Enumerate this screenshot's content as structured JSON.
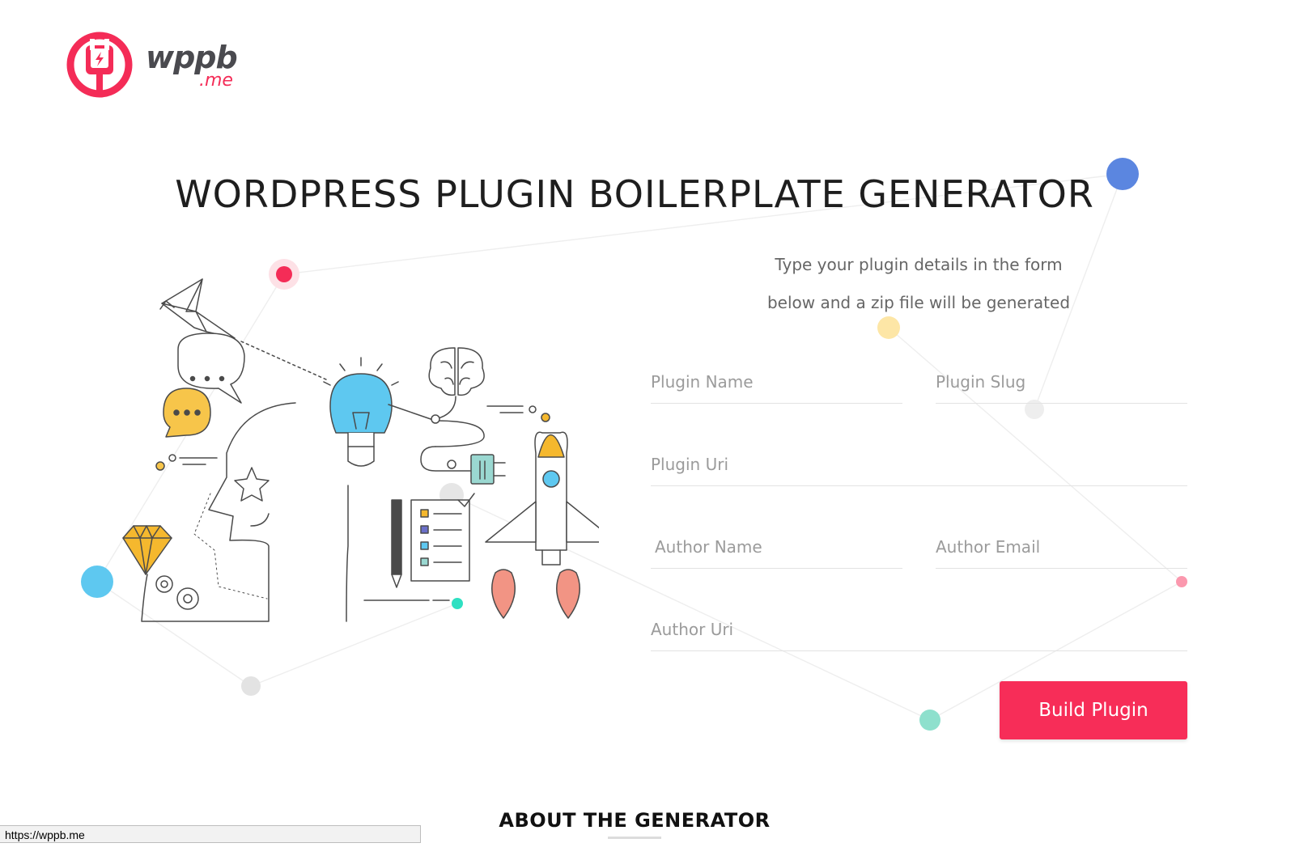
{
  "logo": {
    "name": "wppb",
    "suffix": ".me"
  },
  "title": "WORDPRESS PLUGIN BOILERPLATE GENERATOR",
  "tagline": {
    "line1": "Type your plugin details in the form",
    "line2": "below and a zip file will be generated"
  },
  "form": {
    "plugin_name": {
      "placeholder": "Plugin Name",
      "value": ""
    },
    "plugin_slug": {
      "placeholder": "Plugin Slug",
      "value": ""
    },
    "plugin_uri": {
      "placeholder": "Plugin Uri",
      "value": ""
    },
    "author_name": {
      "placeholder": "Author Name",
      "value": ""
    },
    "author_email": {
      "placeholder": "Author Email",
      "value": ""
    },
    "author_uri": {
      "placeholder": "Author Uri",
      "value": ""
    },
    "submit_label": "Build Plugin"
  },
  "about_heading": "ABOUT THE GENERATOR",
  "status_bar_url": "https://wppb.me",
  "colors": {
    "brand": "#f72d58",
    "text": "#1e1e1e",
    "placeholder": "#9b9b9b",
    "field_border": "#e3e3e3"
  },
  "illustration_icons": [
    "origami-bird-icon",
    "chat-bubbles-icon",
    "lightbulb-icon",
    "brain-icon",
    "rocket-icon",
    "plug-icon",
    "checklist-icon",
    "pen-icon",
    "diamond-icon",
    "gears-icon",
    "star-icon",
    "human-head-icon"
  ]
}
